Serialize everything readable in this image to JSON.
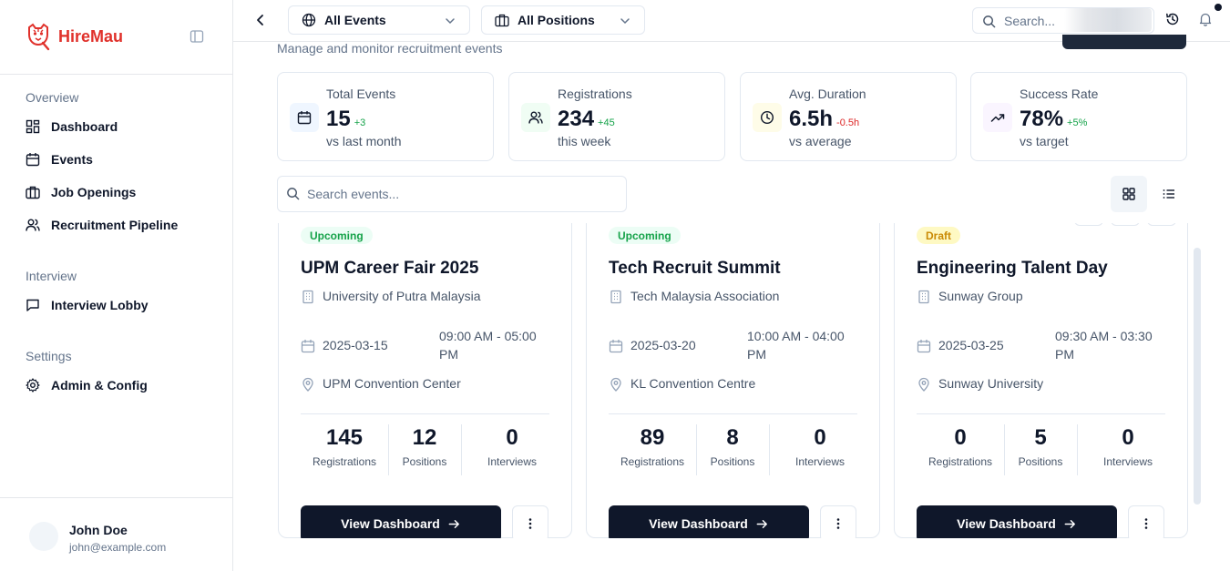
{
  "brand": {
    "name": "HireMau",
    "logo_icon": "tiger-logo-icon",
    "accent": "#e0312b"
  },
  "sidebar": {
    "sections": [
      {
        "title": "Overview",
        "items": [
          {
            "label": "Dashboard",
            "icon": "dashboard-icon"
          },
          {
            "label": "Events",
            "icon": "calendar-icon"
          },
          {
            "label": "Job Openings",
            "icon": "briefcase-icon"
          },
          {
            "label": "Recruitment Pipeline",
            "icon": "users-icon"
          }
        ]
      },
      {
        "title": "Interview",
        "items": [
          {
            "label": "Interview Lobby",
            "icon": "message-icon"
          }
        ]
      },
      {
        "title": "Settings",
        "items": [
          {
            "label": "Admin & Config",
            "icon": "gear-icon"
          }
        ]
      }
    ],
    "user": {
      "name": "John Doe",
      "email": "john@example.com"
    }
  },
  "topbar": {
    "event_filter": "All Events",
    "position_filter": "All Positions",
    "search_placeholder": "Search..."
  },
  "page": {
    "subtitle": "Manage and monitor recruitment events"
  },
  "stats": [
    {
      "label": "Total Events",
      "value": "15",
      "delta": "+3",
      "delta_color": "#16a34a",
      "note": "vs last month",
      "icon": "calendar-icon",
      "icon_bg": "#eff6ff"
    },
    {
      "label": "Registrations",
      "value": "234",
      "delta": "+45",
      "delta_color": "#16a34a",
      "note": "this week",
      "icon": "users-icon",
      "icon_bg": "#f0fdf4"
    },
    {
      "label": "Avg. Duration",
      "value": "6.5h",
      "delta": "-0.5h",
      "delta_color": "#dc2626",
      "note": "vs average",
      "icon": "clock-icon",
      "icon_bg": "#fefce8"
    },
    {
      "label": "Success Rate",
      "value": "78%",
      "delta": "+5%",
      "delta_color": "#16a34a",
      "note": "vs target",
      "icon": "trending-up-icon",
      "icon_bg": "#faf5ff"
    }
  ],
  "events_search_placeholder": "Search events...",
  "events": [
    {
      "status": "Upcoming",
      "title": "UPM Career Fair 2025",
      "org": "University of Putra Malaysia",
      "date": "2025-03-15",
      "time": "09:00 AM - 05:00 PM",
      "location": "UPM Convention Center",
      "registrations": "145",
      "positions": "12",
      "interviews": "0"
    },
    {
      "status": "Upcoming",
      "title": "Tech Recruit Summit",
      "org": "Tech Malaysia Association",
      "date": "2025-03-20",
      "time": "10:00 AM - 04:00 PM",
      "location": "KL Convention Centre",
      "registrations": "89",
      "positions": "8",
      "interviews": "0"
    },
    {
      "status": "Draft",
      "title": "Engineering Talent Day",
      "org": "Sunway Group",
      "date": "2025-03-25",
      "time": "09:30 AM - 03:30 PM",
      "location": "Sunway University",
      "registrations": "0",
      "positions": "5",
      "interviews": "0"
    }
  ],
  "labels": {
    "registrations": "Registrations",
    "positions": "Positions",
    "interviews": "Interviews",
    "view_dashboard": "View Dashboard"
  }
}
